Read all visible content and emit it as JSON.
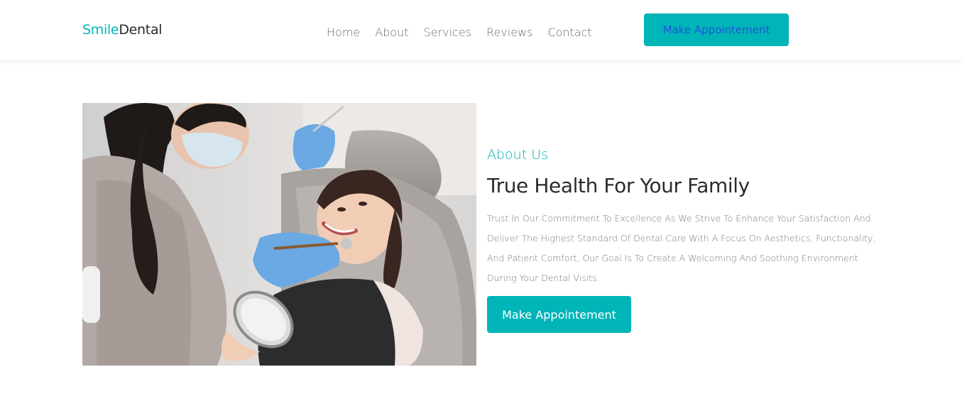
{
  "colors": {
    "accent": "#00b5b8",
    "heading": "#2b2b2b",
    "body_text": "#7a7a7a",
    "nav_text": "#6b6b6b",
    "header_button_text": "#1e55d6"
  },
  "header": {
    "logo": {
      "part1": "Smile",
      "part2": "Dental"
    },
    "nav": [
      {
        "label": "Home"
      },
      {
        "label": "About"
      },
      {
        "label": "Services"
      },
      {
        "label": "Reviews"
      },
      {
        "label": "Contact"
      }
    ],
    "cta_label": "Make Appointement"
  },
  "about": {
    "image_subject": "dentist-treating-child-photo",
    "label": "About Us",
    "title": "True Health For Your Family",
    "description": "Trust In Our Commitment To Excellence As We Strive To Enhance Your Satisfaction And Deliver The Highest Standard Of Dental Care With A Focus On Aesthetics, Functionality, And Patient Comfort, Our Goal Is To Create A Welcoming And Soothing Environment During Your Dental Visits.",
    "cta_label": "Make Appointement"
  }
}
